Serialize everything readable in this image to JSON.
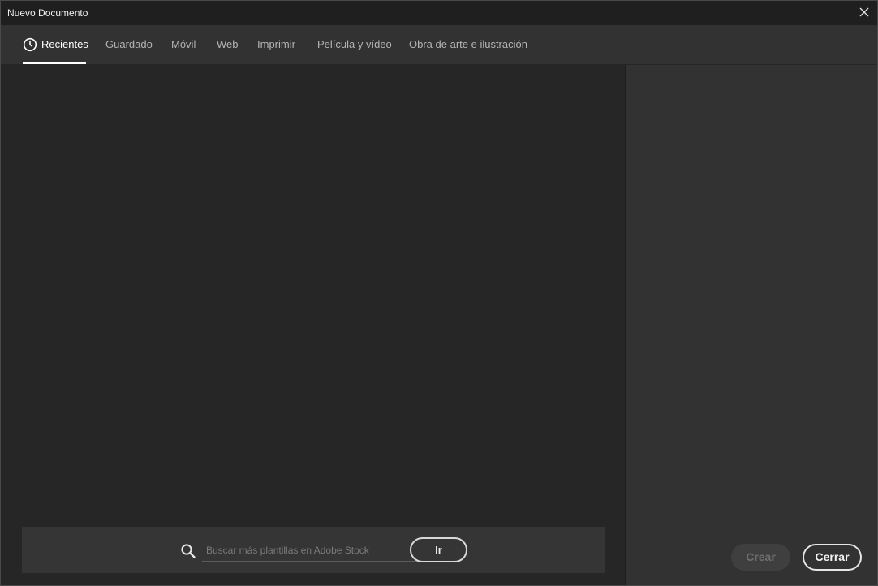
{
  "window": {
    "title": "Nuevo Documento"
  },
  "tabs": [
    {
      "label": "Recientes",
      "active": true,
      "icon": "clock-icon"
    },
    {
      "label": "Guardado",
      "active": false
    },
    {
      "label": "Móvil",
      "active": false
    },
    {
      "label": "Web",
      "active": false
    },
    {
      "label": "Imprimir",
      "active": false
    },
    {
      "label": "Película y vídeo",
      "active": false
    },
    {
      "label": "Obra de arte e ilustración",
      "active": false
    }
  ],
  "search": {
    "placeholder": "Buscar más plantillas en Adobe Stock",
    "value": "",
    "go_label": "Ir"
  },
  "actions": {
    "create_label": "Crear",
    "create_enabled": false,
    "close_label": "Cerrar"
  },
  "colors": {
    "titlebar": "#1f1f1f",
    "main_panel": "#262626",
    "right_panel": "#323232",
    "text_active": "#ffffff",
    "text_inactive": "#b4b4b4"
  }
}
